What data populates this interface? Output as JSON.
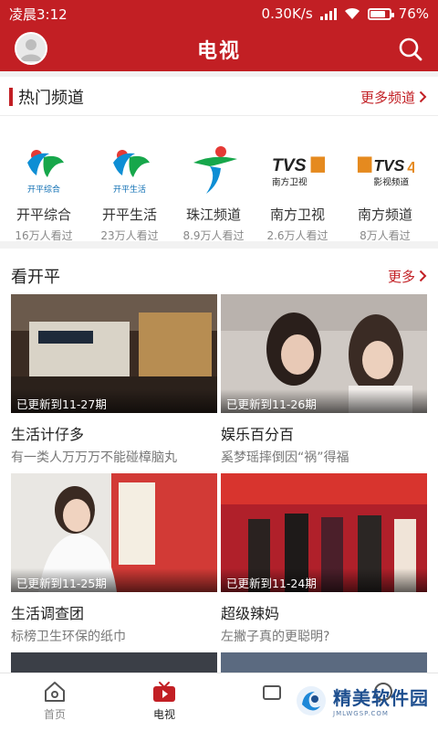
{
  "status": {
    "time": "凌晨3:12",
    "speed": "0.30K/s",
    "battery": "76%"
  },
  "appbar": {
    "title": "电视"
  },
  "hot": {
    "title": "热门频道",
    "more": "更多频道",
    "channels": [
      {
        "name": "开平综合",
        "views": "16万人看过",
        "logo_text": "开平综合"
      },
      {
        "name": "开平生活",
        "views": "23万人看过",
        "logo_text": "开平生活"
      },
      {
        "name": "珠江频道",
        "views": "8.9万人看过"
      },
      {
        "name": "南方卫视",
        "views": "2.6万人看过",
        "logo_text": "南方卫视"
      },
      {
        "name": "南方频道",
        "views": "8万人看过",
        "logo_text": "影视频道"
      }
    ]
  },
  "kaiping": {
    "title": "看开平",
    "more": "更多",
    "items": [
      {
        "badge": "已更新到11-27期",
        "title": "生活计仔多",
        "sub": "有一类人万万万不能碰樟脑丸"
      },
      {
        "badge": "已更新到11-26期",
        "title": "娱乐百分百",
        "sub": "奚梦瑶摔倒因“祸”得福"
      },
      {
        "badge": "已更新到11-25期",
        "title": "生活调查团",
        "sub": "标榜卫生环保的纸巾"
      },
      {
        "badge": "已更新到11-24期",
        "title": "超级辣妈",
        "sub": "左撇子真的更聪明?"
      }
    ]
  },
  "tabs": [
    {
      "label": "首页"
    },
    {
      "label": "电视"
    },
    {
      "label": ""
    },
    {
      "label": ""
    }
  ],
  "watermark": {
    "text": "精美软件园",
    "sub": "JMLWGSP.COM"
  },
  "colors": {
    "brand": "#c21f24"
  }
}
